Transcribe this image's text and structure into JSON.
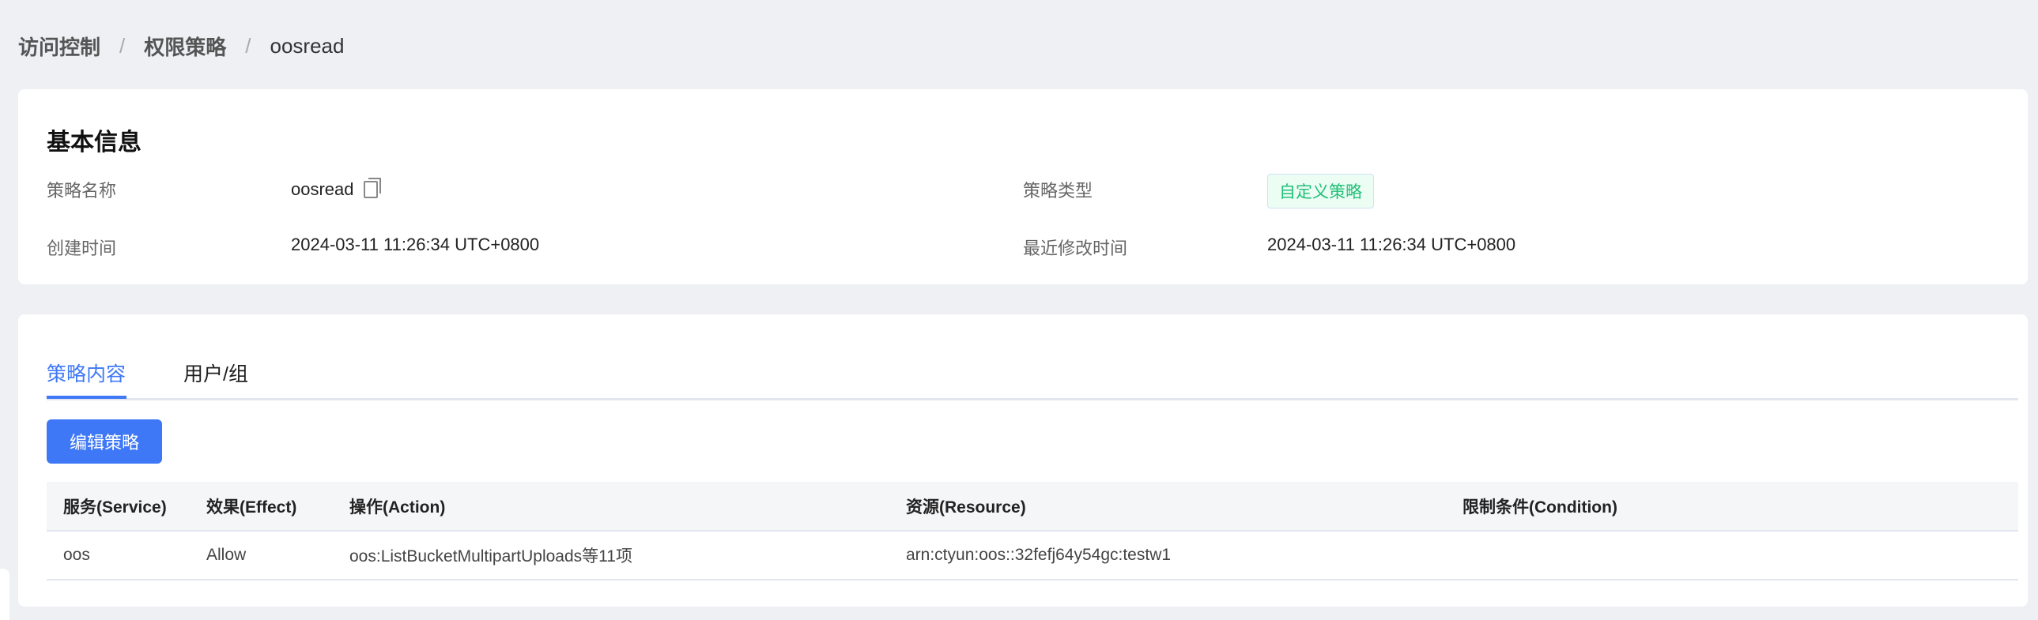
{
  "breadcrumb": {
    "items": [
      "访问控制",
      "权限策略"
    ],
    "current": "oosread"
  },
  "basic_info": {
    "title": "基本信息",
    "policy_name_label": "策略名称",
    "policy_name": "oosread",
    "policy_type_label": "策略类型",
    "policy_type": "自定义策略",
    "created_label": "创建时间",
    "created": "2024-03-11 11:26:34 UTC+0800",
    "modified_label": "最近修改时间",
    "modified": "2024-03-11 11:26:34 UTC+0800"
  },
  "tabs": [
    {
      "label": "策略内容",
      "active": true
    },
    {
      "label": "用户/组",
      "active": false
    }
  ],
  "edit_button": "编辑策略",
  "table": {
    "headers": [
      "服务(Service)",
      "效果(Effect)",
      "操作(Action)",
      "资源(Resource)",
      "限制条件(Condition)"
    ],
    "rows": [
      [
        "oos",
        "Allow",
        "oos:ListBucketMultipartUploads等11项",
        "arn:ctyun:oos::32fefj64y54gc:testw1",
        ""
      ]
    ]
  },
  "colors": {
    "accent": "#3f78f6",
    "tag_green": "#22c07a",
    "background": "#eef0f4"
  }
}
